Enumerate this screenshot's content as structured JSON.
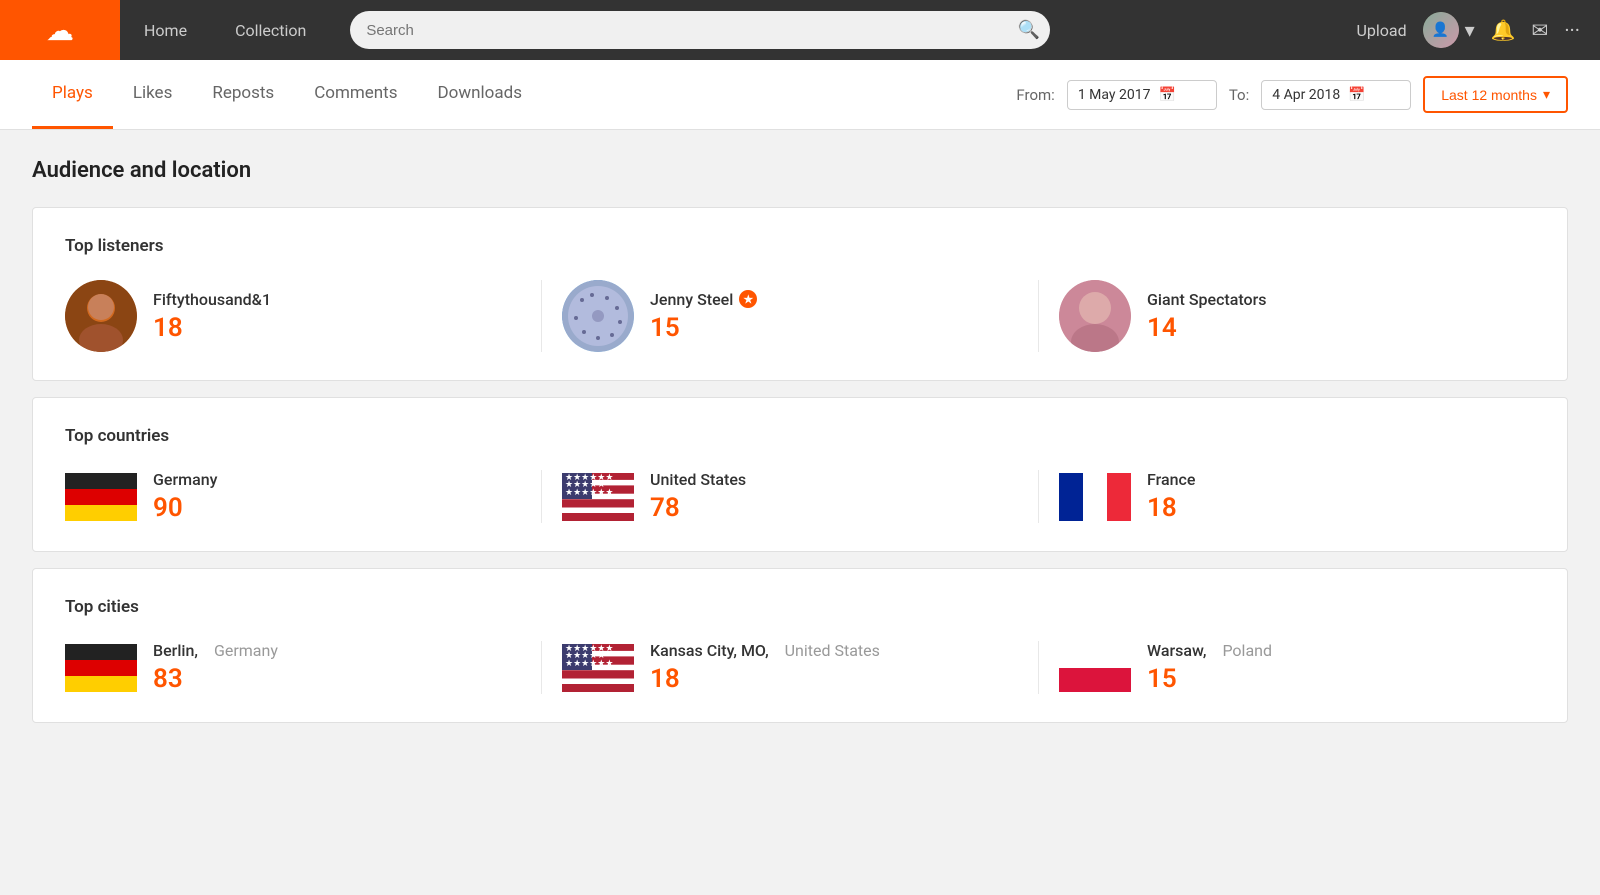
{
  "nav": {
    "home_label": "Home",
    "collection_label": "Collection",
    "search_placeholder": "Search",
    "upload_label": "Upload"
  },
  "tabs": {
    "plays_label": "Plays",
    "likes_label": "Likes",
    "reposts_label": "Reposts",
    "comments_label": "Comments",
    "downloads_label": "Downloads"
  },
  "date_controls": {
    "from_label": "From:",
    "to_label": "To:",
    "from_date": "1 May 2017",
    "to_date": "4 Apr 2018",
    "last_months_label": "Last 12 months"
  },
  "audience_section": {
    "title": "Audience and location"
  },
  "top_listeners": {
    "title": "Top listeners",
    "items": [
      {
        "name": "Fiftythousand&1",
        "count": "18",
        "has_pro": false
      },
      {
        "name": "Jenny Steel",
        "count": "15",
        "has_pro": true
      },
      {
        "name": "Giant Spectators",
        "count": "14",
        "has_pro": false
      }
    ]
  },
  "top_countries": {
    "title": "Top countries",
    "items": [
      {
        "name": "Germany",
        "count": "90",
        "flag": "🇩🇪"
      },
      {
        "name": "United States",
        "count": "78",
        "flag": "🇺🇸"
      },
      {
        "name": "France",
        "count": "18",
        "flag": "🇫🇷"
      }
    ]
  },
  "top_cities": {
    "title": "Top cities",
    "items": [
      {
        "city": "Berlin,",
        "country": "Germany",
        "count": "83",
        "flag": "🇩🇪"
      },
      {
        "city": "Kansas City, MO,",
        "country": "United States",
        "count": "18",
        "flag": "🇺🇸"
      },
      {
        "city": "Warsaw,",
        "country": "Poland",
        "count": "15",
        "flag": "🇵🇱"
      }
    ]
  }
}
